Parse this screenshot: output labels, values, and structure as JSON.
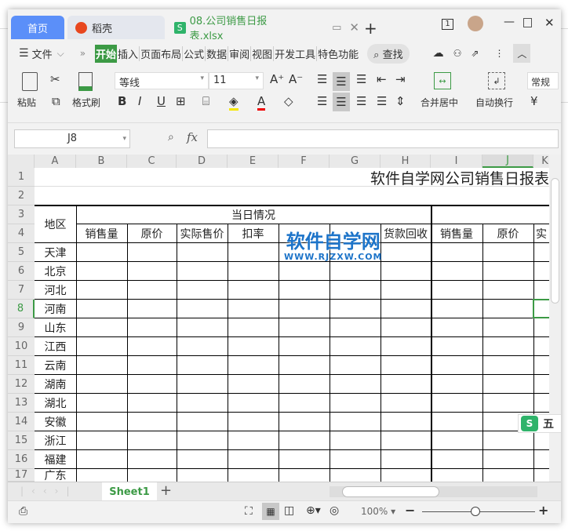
{
  "tabs": {
    "home": "首页",
    "docer": "稻壳",
    "file": "08.公司销售日报表.xlsx",
    "page_num": "1"
  },
  "menu": {
    "file": "文件",
    "items": [
      "开始",
      "插入",
      "页面布局",
      "公式",
      "数据",
      "审阅",
      "视图",
      "开发工具",
      "特色功能"
    ],
    "search": "查找"
  },
  "toolbar": {
    "paste": "粘贴",
    "format_painter": "格式刷",
    "font": "等线",
    "size": "11",
    "merge": "合并居中",
    "wrap": "自动换行",
    "number_format": "常规",
    "currency": "¥"
  },
  "formula": {
    "name_box": "J8",
    "fx": "fx",
    "value": ""
  },
  "columns": [
    "A",
    "B",
    "C",
    "D",
    "E",
    "F",
    "G",
    "H",
    "I",
    "J",
    "K"
  ],
  "sheet": {
    "title": "软件自学网公司销售日报表",
    "region_header": "地区",
    "group_header": "当日情况",
    "sub_headers": [
      "销售量",
      "原价",
      "实际售价",
      "扣率",
      "",
      "",
      "货款回收",
      "销售量",
      "原价",
      "实"
    ],
    "regions": [
      "天津",
      "北京",
      "河北",
      "河南",
      "山东",
      "江西",
      "云南",
      "湖南",
      "湖北",
      "安徽",
      "浙江",
      "福建",
      "广东"
    ],
    "row_numbers": [
      "1",
      "2",
      "3",
      "4",
      "5",
      "6",
      "7",
      "8",
      "9",
      "10",
      "11",
      "12",
      "13",
      "14",
      "15",
      "16",
      "17"
    ]
  },
  "watermark": {
    "main": "软件自学网",
    "url": "WWW.RJZXW.COM"
  },
  "float_badge": "五",
  "sheet_tabs": [
    "Sheet1"
  ],
  "status": {
    "zoom": "100%"
  },
  "colors": {
    "accent": "#3c9a45",
    "home_tab": "#5b8ff9",
    "selection": "#3c9a45"
  }
}
